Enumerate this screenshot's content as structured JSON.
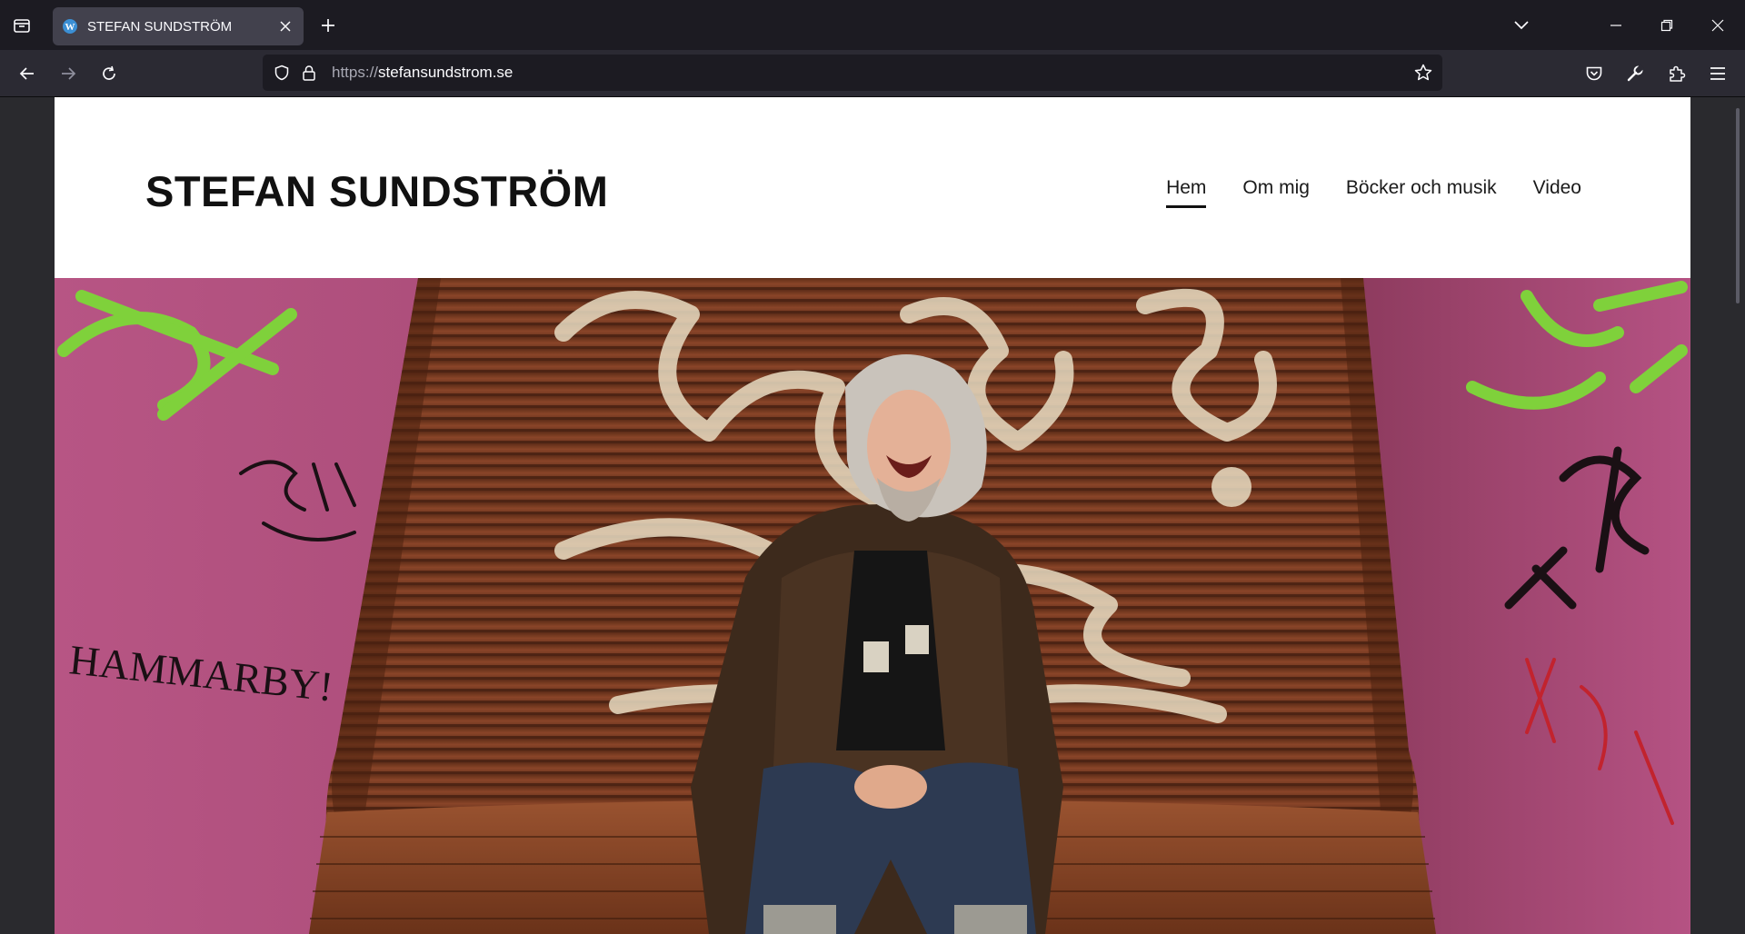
{
  "browser": {
    "tab_title": "STEFAN SUNDSTRÖM",
    "url_scheme": "https://",
    "url_host": "stefansundstrom.se"
  },
  "site": {
    "title": "STEFAN SUNDSTRÖM",
    "menu": [
      {
        "label": "Hem",
        "active": true
      },
      {
        "label": "Om mig",
        "active": false
      },
      {
        "label": "Böcker och musik",
        "active": false
      },
      {
        "label": "Video",
        "active": false
      }
    ]
  },
  "hero": {
    "graffiti_text": "HAMMARBY!"
  },
  "colors": {
    "chrome_dark": "#1c1b22",
    "chrome_toolbar": "#2b2a33",
    "tab_active": "#42414d",
    "wall_pink": "#a3466a",
    "graffiti_green": "#7fd13b",
    "bench_brown": "#7a3e22"
  }
}
